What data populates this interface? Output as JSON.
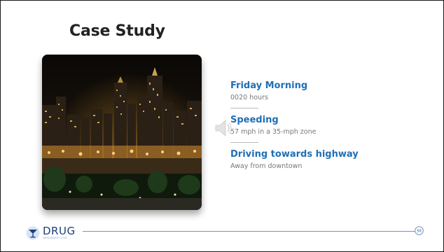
{
  "slide": {
    "title": "Case Study",
    "facts": [
      {
        "title": "Friday Morning",
        "subtitle": "0020 hours"
      },
      {
        "title": "Speeding",
        "subtitle": "57 mph in a 35-mph zone"
      },
      {
        "title": "Driving towards highway",
        "subtitle": "Away from downtown"
      }
    ],
    "image": "night city skyline photo"
  },
  "footer": {
    "logo_word": "DRUG",
    "logo_small": "IMPAIRMENT.COM",
    "page_number": "50"
  },
  "icons": {
    "speaker": "speaker-icon",
    "logo": "cocktail-glass-icon"
  },
  "colors": {
    "accent": "#1f6fb5",
    "title": "#222222",
    "muted": "#777777",
    "footer_line": "#6d95c7",
    "logo": "#1c3f7a"
  }
}
